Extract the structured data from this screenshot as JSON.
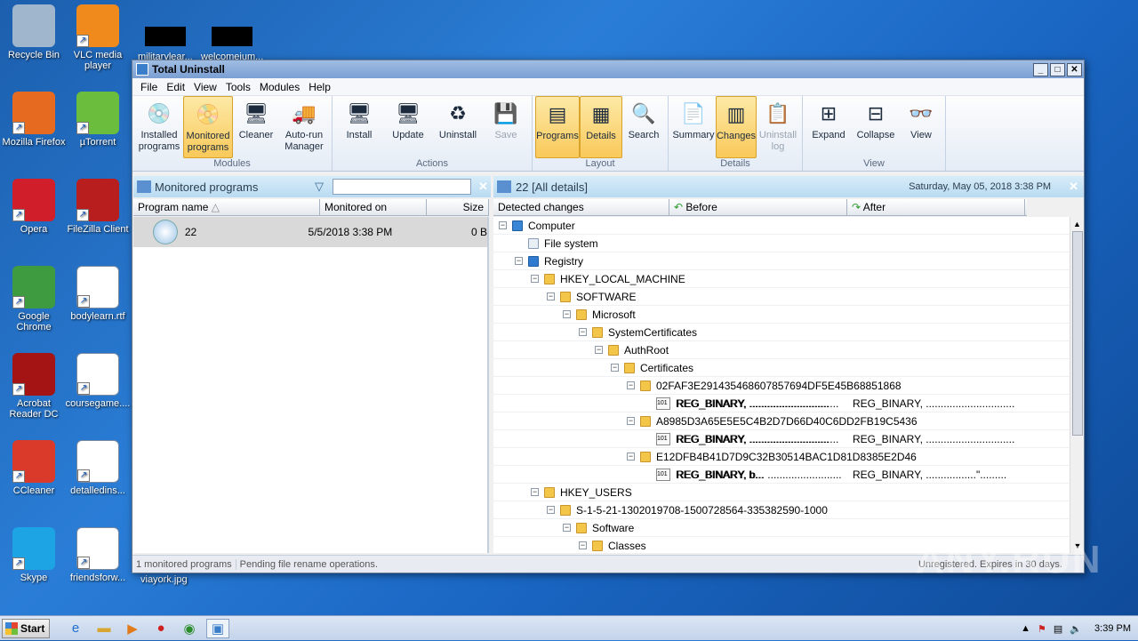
{
  "desktop": {
    "icons": [
      {
        "label": "Recycle Bin",
        "icon": "recycle-bin-icon"
      },
      {
        "label": "VLC media player",
        "icon": "vlc-icon"
      },
      {
        "label": "Mozilla Firefox",
        "icon": "firefox-icon"
      },
      {
        "label": "µTorrent",
        "icon": "utorrent-icon"
      },
      {
        "label": "Opera",
        "icon": "opera-icon"
      },
      {
        "label": "FileZilla Client",
        "icon": "filezilla-icon"
      },
      {
        "label": "Google Chrome",
        "icon": "chrome-icon"
      },
      {
        "label": "bodylearn.rtf",
        "icon": "word-doc-icon"
      },
      {
        "label": "Acrobat Reader DC",
        "icon": "acrobat-icon"
      },
      {
        "label": "coursegame....",
        "icon": "word-doc-icon"
      },
      {
        "label": "CCleaner",
        "icon": "ccleaner-icon"
      },
      {
        "label": "detalledins...",
        "icon": "word-doc-icon"
      },
      {
        "label": "Skype",
        "icon": "skype-icon"
      },
      {
        "label": "friendsforw...",
        "icon": "word-doc-icon"
      }
    ],
    "partial_labels": [
      "militarylear...",
      "welcomeium...",
      "viayork.jpg"
    ]
  },
  "window": {
    "title": "Total Uninstall",
    "menu": [
      "File",
      "Edit",
      "View",
      "Tools",
      "Modules",
      "Help"
    ],
    "ribbon": {
      "modules": {
        "name": "Modules",
        "buttons": [
          "Installed programs",
          "Monitored programs",
          "Cleaner",
          "Auto-run Manager"
        ]
      },
      "actions": {
        "name": "Actions",
        "buttons": [
          "Install",
          "Update",
          "Uninstall",
          "Save"
        ]
      },
      "layout": {
        "name": "Layout",
        "buttons": [
          "Programs",
          "Details",
          "Search"
        ]
      },
      "details": {
        "name": "Details",
        "buttons": [
          "Summary",
          "Changes",
          "Uninstall log"
        ]
      },
      "view": {
        "name": "View",
        "buttons": [
          "Expand",
          "Collapse",
          "View"
        ]
      }
    },
    "left_panel": {
      "title": "Monitored programs",
      "search_value": "",
      "columns": [
        "Program name",
        "Monitored on",
        "Size"
      ],
      "rows": [
        {
          "name": "22",
          "date": "5/5/2018 3:38 PM",
          "size": "0 B"
        }
      ]
    },
    "right_panel": {
      "title": "22 [All details]",
      "date": "Saturday, May 05, 2018 3:38 PM",
      "columns": [
        "Detected changes",
        "Before",
        "After"
      ],
      "tree": [
        {
          "label": "Computer",
          "level": 0,
          "type": "computer"
        },
        {
          "label": "File system",
          "level": 1,
          "type": "file"
        },
        {
          "label": "Registry",
          "level": 1,
          "type": "registry"
        },
        {
          "label": "HKEY_LOCAL_MACHINE",
          "level": 2,
          "type": "folder"
        },
        {
          "label": "SOFTWARE",
          "level": 3,
          "type": "folder"
        },
        {
          "label": "Microsoft",
          "level": 4,
          "type": "folder"
        },
        {
          "label": "SystemCertificates",
          "level": 5,
          "type": "folder"
        },
        {
          "label": "AuthRoot",
          "level": 6,
          "type": "folder"
        },
        {
          "label": "Certificates",
          "level": 7,
          "type": "folder"
        },
        {
          "label": "02FAF3E291435468607857694DF5E45B68851868",
          "level": 8,
          "type": "folder"
        },
        {
          "label": "REG_BINARY, ...........................",
          "level": 9,
          "type": "value",
          "before": "REG_BINARY, ..............................",
          "after": "REG_BINARY, .............................."
        },
        {
          "label": "A8985D3A65E5E5C4B2D7D66D40C6DD2FB19C5436",
          "level": 8,
          "type": "folder"
        },
        {
          "label": "REG_BINARY, ...........................",
          "level": 9,
          "type": "value",
          "before": "REG_BINARY, ..............................",
          "after": "REG_BINARY, .............................."
        },
        {
          "label": "E12DFB4B41D7D9C32B30514BAC1D81D8385E2D46",
          "level": 8,
          "type": "folder"
        },
        {
          "label": "REG_BINARY, b...",
          "level": 9,
          "type": "value",
          "before": "REG_BINARY, b... .........................",
          "after": "REG_BINARY, .................\"........."
        },
        {
          "label": "HKEY_USERS",
          "level": 2,
          "type": "folder"
        },
        {
          "label": "S-1-5-21-1302019708-1500728564-335382590-1000",
          "level": 3,
          "type": "folder"
        },
        {
          "label": "Software",
          "level": 4,
          "type": "folder"
        },
        {
          "label": "Classes",
          "level": 5,
          "type": "folder"
        }
      ]
    },
    "status": [
      "1 monitored programs",
      "Pending file rename operations.",
      "Unregistered. Expires in 30 days."
    ]
  },
  "taskbar": {
    "start_label": "Start",
    "clock": "3:39 PM"
  },
  "watermark": "ANY.RUN"
}
